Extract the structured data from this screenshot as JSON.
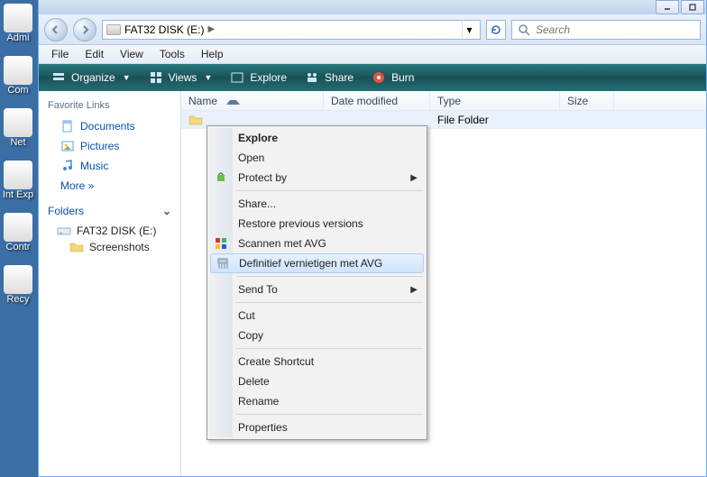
{
  "desktop": {
    "items": [
      {
        "label": "Admi"
      },
      {
        "label": "Com"
      },
      {
        "label": "Net"
      },
      {
        "label": "Int Exp"
      },
      {
        "label": "Contr"
      },
      {
        "label": "Recy"
      }
    ]
  },
  "breadcrumb": {
    "drive": "FAT32 DISK (E:)"
  },
  "search": {
    "placeholder": "Search"
  },
  "menu": {
    "file": "File",
    "edit": "Edit",
    "view": "View",
    "tools": "Tools",
    "help": "Help"
  },
  "toolbar": {
    "organize": "Organize",
    "views": "Views",
    "explore": "Explore",
    "share": "Share",
    "burn": "Burn"
  },
  "sidebar": {
    "fav_heading": "Favorite Links",
    "documents": "Documents",
    "pictures": "Pictures",
    "music": "Music",
    "more": "More »",
    "folders_heading": "Folders",
    "tree": {
      "root": "FAT32 DISK (E:)",
      "child": "Screenshots"
    }
  },
  "columns": {
    "name": "Name",
    "date": "Date modified",
    "type": "Type",
    "size": "Size"
  },
  "rows": [
    {
      "name": "",
      "type": "File Folder"
    }
  ],
  "context": {
    "explore": "Explore",
    "open": "Open",
    "protect_by": "Protect by",
    "share": "Share...",
    "restore": "Restore previous versions",
    "scan_avg": "Scannen met AVG",
    "shred_avg": "Definitief vernietigen met AVG",
    "send_to": "Send To",
    "cut": "Cut",
    "copy": "Copy",
    "shortcut": "Create Shortcut",
    "delete": "Delete",
    "rename": "Rename",
    "properties": "Properties"
  }
}
